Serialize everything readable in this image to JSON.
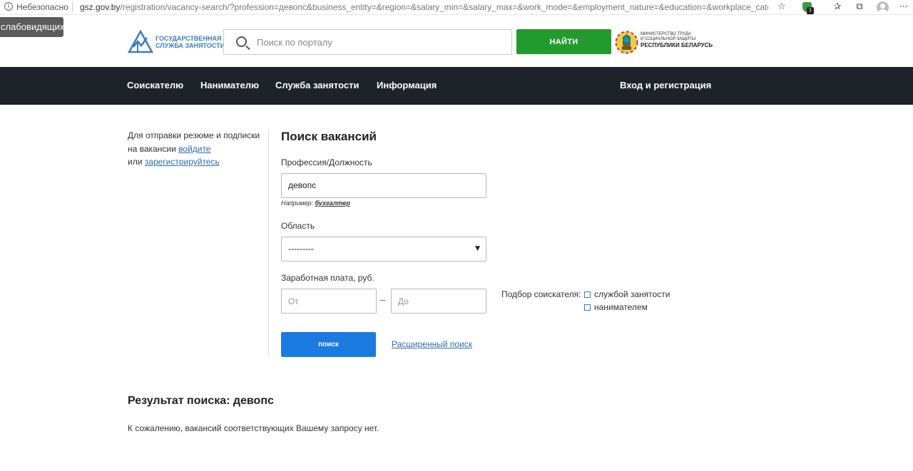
{
  "browser": {
    "security_label": "Небезопасно",
    "url_host": "gsz.gov.by",
    "url_rest": "/registration/vacancy-search/?profession=девопс&business_entity=&region=&salary_min=&salary_max=&work_mode=&employment_nature=&education=&workplace_cate...",
    "extension_badge": "1"
  },
  "accessibility": {
    "label": "слабовидящих"
  },
  "header": {
    "logo_line1": "ГОСУДАРСТВЕННАЯ",
    "logo_line2": "СЛУЖБА ЗАНЯТОСТИ",
    "search_placeholder": "Поиск по порталу",
    "search_button": "НАЙТИ",
    "ministry_line1": "МИНИСТЕРСТВО ТРУДА",
    "ministry_line2": "И СОЦИАЛЬНОЙ ЗАЩИТЫ",
    "ministry_line3": "РЕСПУБЛИКИ БЕЛАРУСЬ"
  },
  "nav": {
    "items": [
      "Соискателю",
      "Нанимателю",
      "Служба занятости",
      "Информация"
    ],
    "login": "Вход и регистрация"
  },
  "sidebar": {
    "text_before": "Для отправки резюме и подписки на вакансии",
    "login_link": "войдите",
    "text_or": "или",
    "register_link": "зарегистрируйтесь"
  },
  "form": {
    "title": "Поиск вакансий",
    "profession_label": "Профессия/Должность",
    "profession_value": "девопс",
    "hint_prefix": "Например:",
    "hint_example": "бухгалтер",
    "region_label": "Область",
    "region_value": "---------",
    "salary_label": "Заработная плата, руб.",
    "salary_from_placeholder": "От",
    "salary_to_placeholder": "До",
    "salary_dash": "–",
    "selection_label": "Подбор соискателя:",
    "selection_options": [
      "службой занятости",
      "нанимателем"
    ],
    "search_button": "поиск",
    "advanced_link": "Расширенный поиск"
  },
  "results": {
    "title": "Результат поиска: девопс",
    "empty_message": "К сожалению, вакансий соответствующих Вашему запросу нет."
  },
  "colors": {
    "nav_bg": "#1e2229",
    "find_button": "#239a2e",
    "search_button": "#1a7ae0",
    "link": "#2a6db6"
  }
}
